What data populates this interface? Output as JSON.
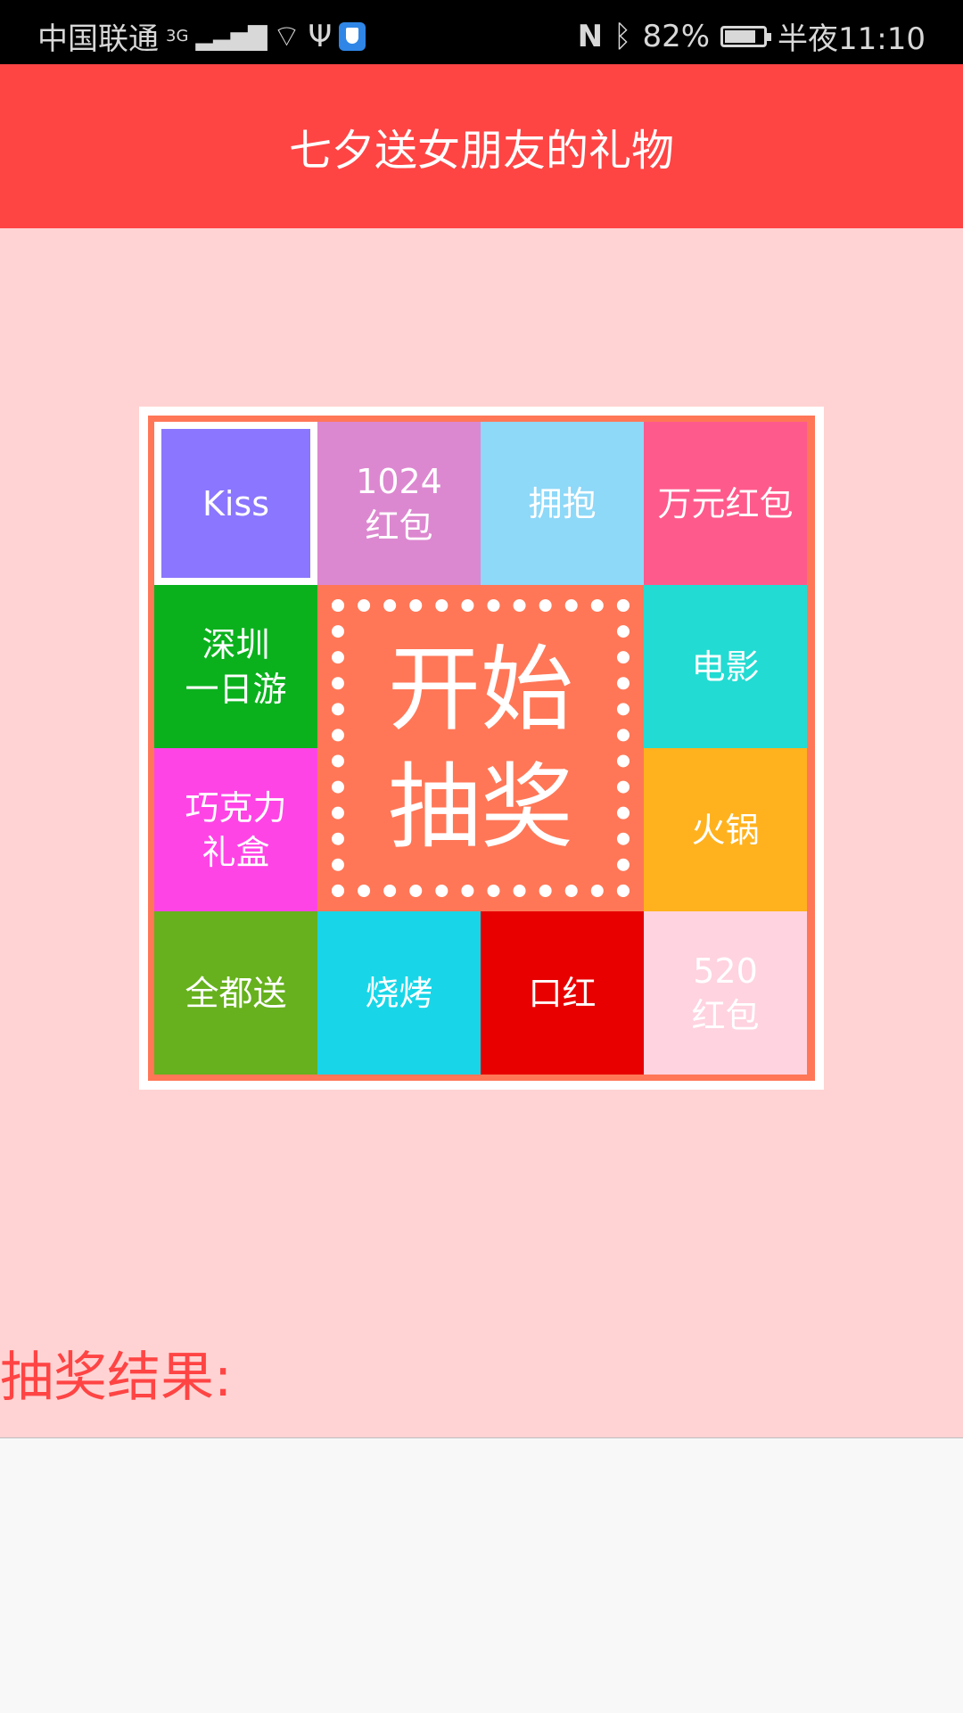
{
  "status_bar": {
    "carrier": "中国联通",
    "network": "3G",
    "battery_percent": "82%",
    "battery_level": 0.82,
    "time": "半夜11:10",
    "icons": [
      "signal-icon",
      "wifi-icon",
      "usb-icon",
      "shield-app-icon",
      "nfc-icon",
      "bluetooth-icon",
      "battery-icon"
    ]
  },
  "app_bar": {
    "title": "七夕送女朋友的礼物",
    "color": "#ff4444"
  },
  "board": {
    "start_button": "开始\n抽奖",
    "selected_index": 0,
    "prizes": [
      {
        "label": "Kiss",
        "color": "#8a76ff"
      },
      {
        "label": "1024\n红包",
        "color": "#dc88d0"
      },
      {
        "label": "拥抱",
        "color": "#8ed8f8"
      },
      {
        "label": "万元红包",
        "color": "#ff5a8c"
      },
      {
        "label": "电影",
        "color": "#22dbd2"
      },
      {
        "label": "火锅",
        "color": "#ffb21e"
      },
      {
        "label": "520\n红包",
        "color": "#ffd3e0"
      },
      {
        "label": "口红",
        "color": "#e80000"
      },
      {
        "label": "烧烤",
        "color": "#18d6e8"
      },
      {
        "label": "全都送",
        "color": "#66b11d"
      },
      {
        "label": "巧克力\n礼盒",
        "color": "#ff44e6"
      },
      {
        "label": "深圳\n一日游",
        "color": "#0ab11d"
      }
    ]
  },
  "result": {
    "label": "抽奖结果:",
    "value": ""
  }
}
